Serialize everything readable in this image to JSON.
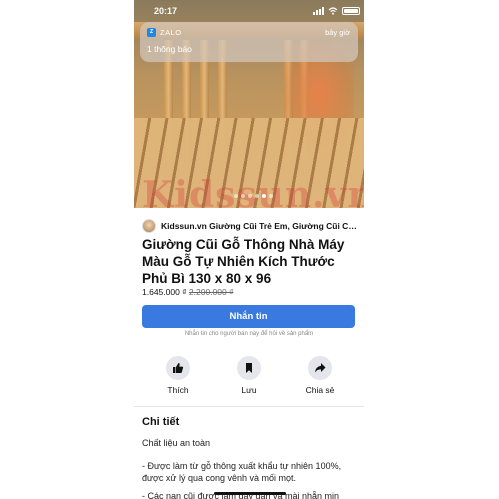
{
  "status_bar": {
    "time": "20:17"
  },
  "notification": {
    "app_name": "ZALO",
    "time": "bây giờ",
    "message": "1 thông báo"
  },
  "hero": {
    "watermark": "Kidssun.vn",
    "image_count": 6,
    "active_index": 4
  },
  "shop": {
    "name": "Kidssun.vn Giường Cũi Trẻ Em, Giường Cũi Chất L..."
  },
  "product": {
    "title": "Giường Cũi Gỗ Thông Nhà Máy Màu Gỗ Tự Nhiên Kích Thước Phủ Bì 130 x 80 x 96",
    "price": "1.645.000 ₫",
    "old_price": "2.200.000 ₫"
  },
  "message_button": {
    "label": "Nhắn tin",
    "hint": "Nhắn tin cho người bán này để hỏi về sản phẩm"
  },
  "actions": [
    {
      "label": "Thích",
      "icon": "thumbs-up-icon"
    },
    {
      "label": "Lưu",
      "icon": "bookmark-icon"
    },
    {
      "label": "Chia sẻ",
      "icon": "share-icon"
    }
  ],
  "details": {
    "heading": "Chi tiết",
    "lines": [
      "Chất liệu an toàn",
      "- Được làm từ gỗ thông xuất khẩu tự nhiên 100%, được xử lý qua cong vênh và mối mọt.",
      "- Các nan cũi được làm dày dặn và mài nhẵn mịn"
    ]
  },
  "colors": {
    "primary": "#3a79e0",
    "icon_bg": "#e4e6eb",
    "zalo": "#1e88e5"
  }
}
